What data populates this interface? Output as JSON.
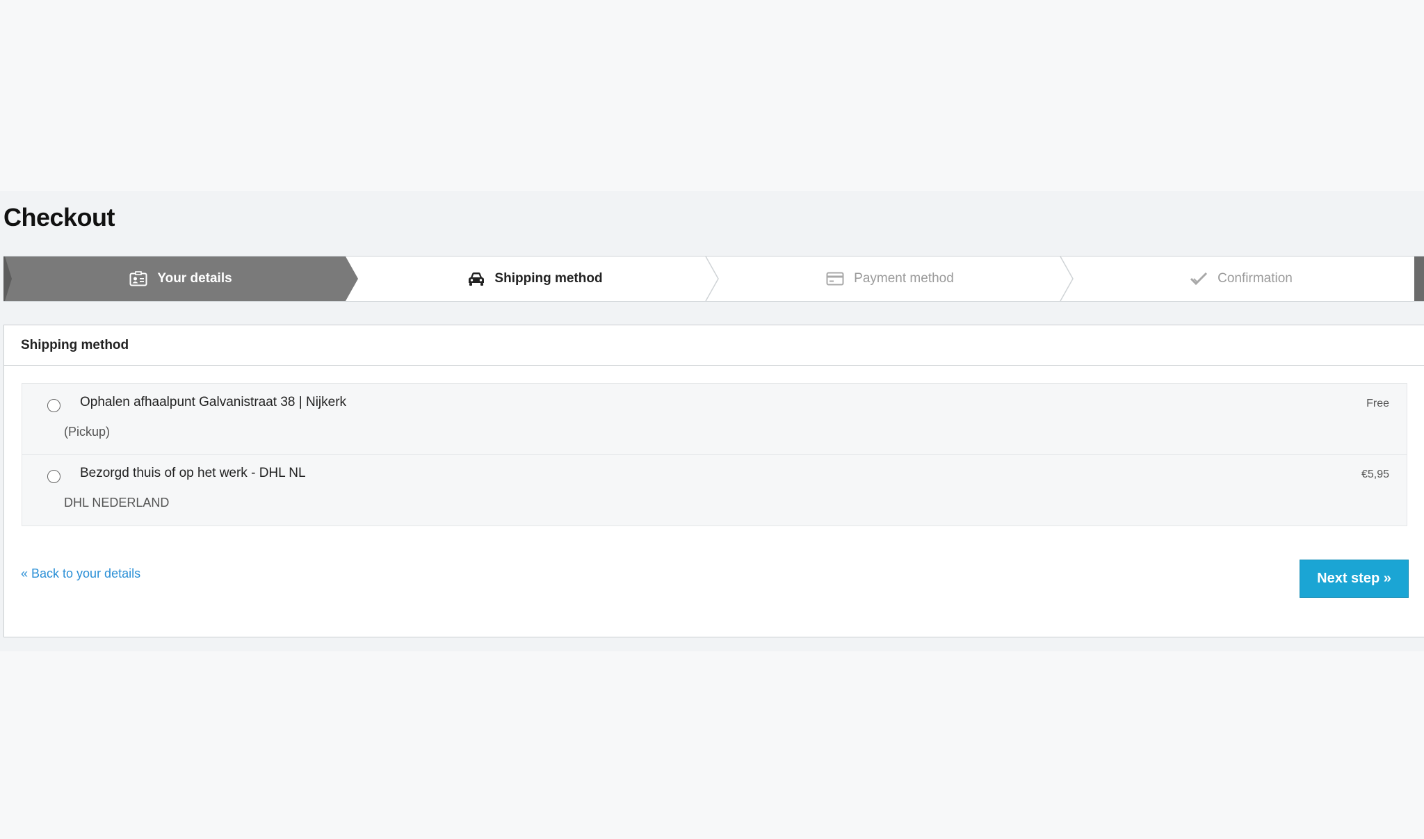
{
  "page": {
    "title": "Checkout"
  },
  "steps": [
    {
      "label": "Your details",
      "icon": "id-card-icon",
      "state": "completed"
    },
    {
      "label": "Shipping method",
      "icon": "car-icon",
      "state": "active"
    },
    {
      "label": "Payment method",
      "icon": "credit-card-icon",
      "state": "upcoming"
    },
    {
      "label": "Confirmation",
      "icon": "checkmark-icon",
      "state": "upcoming"
    }
  ],
  "panel": {
    "heading": "Shipping method",
    "options": [
      {
        "title": "Ophalen afhaalpunt Galvanistraat 38 | Nijkerk",
        "subtitle": "(Pickup)",
        "price": "Free",
        "selected": false
      },
      {
        "title": "Bezorgd thuis of op het werk - DHL NL",
        "subtitle": "DHL NEDERLAND",
        "price": "€5,95",
        "selected": false
      }
    ],
    "back_link": "« Back to your details",
    "next_button": "Next step »"
  },
  "colors": {
    "accent": "#1ba5d4",
    "link": "#2a8fd6",
    "step_completed_bg": "#7a7a7a"
  }
}
